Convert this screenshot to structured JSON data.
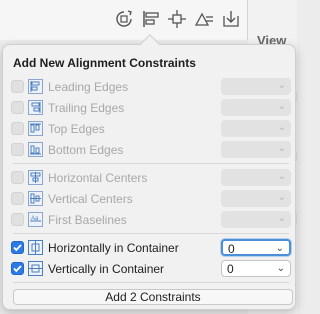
{
  "toolbar": {
    "icons": [
      "update-frames-icon",
      "align-icon",
      "add-constraints-icon",
      "resolve-issues-icon",
      "embed-in-icon"
    ]
  },
  "inspector": {
    "section_label": "View"
  },
  "popover": {
    "title": "Add New Alignment Constraints",
    "constraints": [
      {
        "label": "Leading Edges",
        "checked": false,
        "enabled": false,
        "value": ""
      },
      {
        "label": "Trailing Edges",
        "checked": false,
        "enabled": false,
        "value": ""
      },
      {
        "label": "Top Edges",
        "checked": false,
        "enabled": false,
        "value": ""
      },
      {
        "label": "Bottom Edges",
        "checked": false,
        "enabled": false,
        "value": ""
      },
      {
        "label": "Horizontal Centers",
        "checked": false,
        "enabled": false,
        "value": ""
      },
      {
        "label": "Vertical Centers",
        "checked": false,
        "enabled": false,
        "value": ""
      },
      {
        "label": "First Baselines",
        "checked": false,
        "enabled": false,
        "value": ""
      },
      {
        "label": "Horizontally in Container",
        "checked": true,
        "enabled": true,
        "value": "0"
      },
      {
        "label": "Vertically in Container",
        "checked": true,
        "enabled": true,
        "value": "0"
      }
    ],
    "add_button_label": "Add 2 Constraints"
  },
  "colors": {
    "accent": "#2c7be5",
    "focus_ring": "#4a90d9",
    "disabled_text": "#a8a8a8",
    "icon_blue": "#4a7fc1"
  }
}
